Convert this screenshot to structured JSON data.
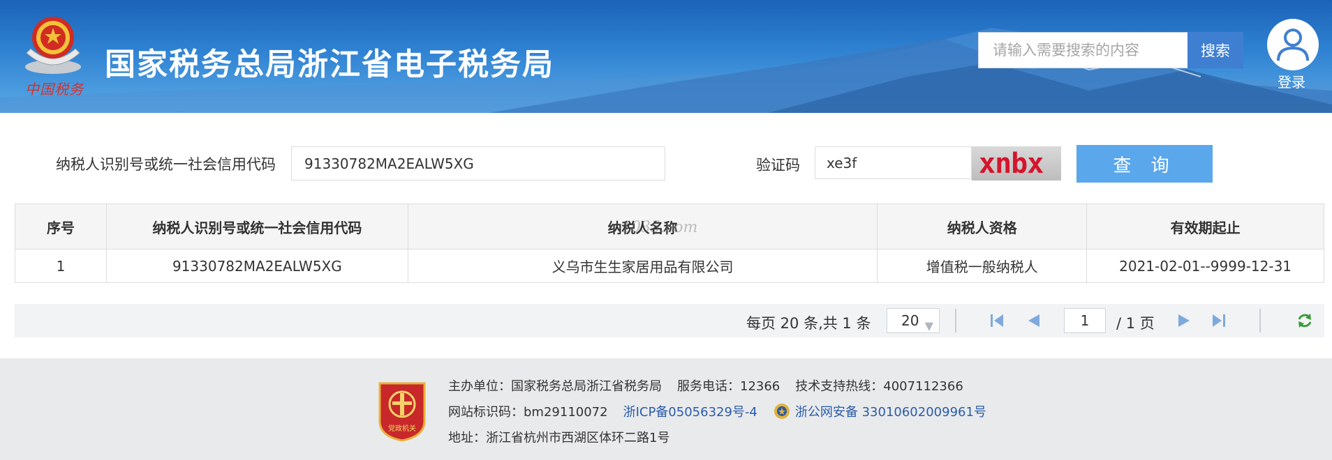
{
  "header": {
    "site_title": "国家税务总局浙江省电子税务局",
    "brand_script": "中国税务",
    "search_placeholder": "请输入需要搜索的内容",
    "search_button": "搜索",
    "login_label": "登录",
    "icons": [
      "tax-emblem-icon",
      "user-icon"
    ]
  },
  "query_form": {
    "taxpayer_id_label": "纳税人识别号或统一社会信用代码",
    "taxpayer_id_value": "91330782MA2EALW5XG",
    "captcha_label": "验证码",
    "captcha_value": "xe3f",
    "captcha_image_text": "xnbx",
    "query_button": "查 询"
  },
  "table": {
    "columns": [
      "序号",
      "纳税人识别号或统一社会信用代码",
      "纳税人名称",
      "纳税人资格",
      "有效期起止"
    ],
    "rows": [
      [
        "1",
        "91330782MA2EALW5XG",
        "义乌市生生家居用品有限公司",
        "增值税一般纳税人",
        "2021-02-01--9999-12-31"
      ]
    ],
    "watermark": "1035.com"
  },
  "pager": {
    "summary": "每页 20 条,共 1 条",
    "page_size": "20",
    "current_page": "1",
    "total_pages": "/ 1 页",
    "icons": [
      "first-page-icon",
      "prev-page-icon",
      "next-page-icon",
      "last-page-icon",
      "refresh-icon"
    ]
  },
  "footer": {
    "host_label": "主办单位：",
    "host_value": "国家税务总局浙江省税务局",
    "phone": "服务电话：12366",
    "tech_hotline": "技术支持热线：4007112366",
    "site_code": "网站标识码：bm29110072",
    "icp": "浙ICP备05056329号-4",
    "police_record": "浙公网安备 33010602009961号",
    "address": "地址：浙江省杭州市西湖区体环二路1号",
    "badge_text": "党政机关"
  },
  "colors": {
    "header_blue": "#2f82d2",
    "search_button": "#3f7fd1",
    "query_button": "#5aa7ec",
    "link": "#2a5caa",
    "captcha_red": "#d4152c"
  }
}
